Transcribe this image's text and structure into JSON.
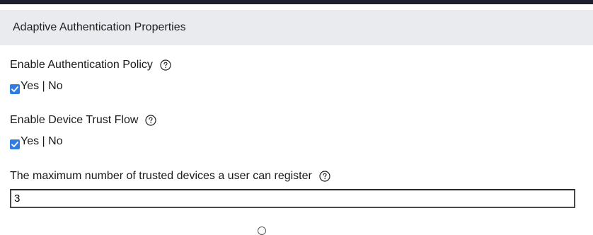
{
  "header": {
    "title": "Adaptive Authentication Properties"
  },
  "fields": {
    "auth_policy": {
      "label": "Enable Authentication Policy",
      "toggle_text": "Yes | No",
      "checked": true
    },
    "device_trust": {
      "label": "Enable Device Trust Flow",
      "toggle_text": "Yes | No",
      "checked": true
    },
    "max_devices": {
      "label": "The maximum number of trusted devices a user can register",
      "value": "3"
    }
  },
  "icons": {
    "help": "help-circle-icon",
    "checkmark": "checkmark-icon"
  },
  "colors": {
    "header_bg": "#e9ebef",
    "topbar": "#1b1f2e",
    "checkbox": "#2f7de1"
  }
}
